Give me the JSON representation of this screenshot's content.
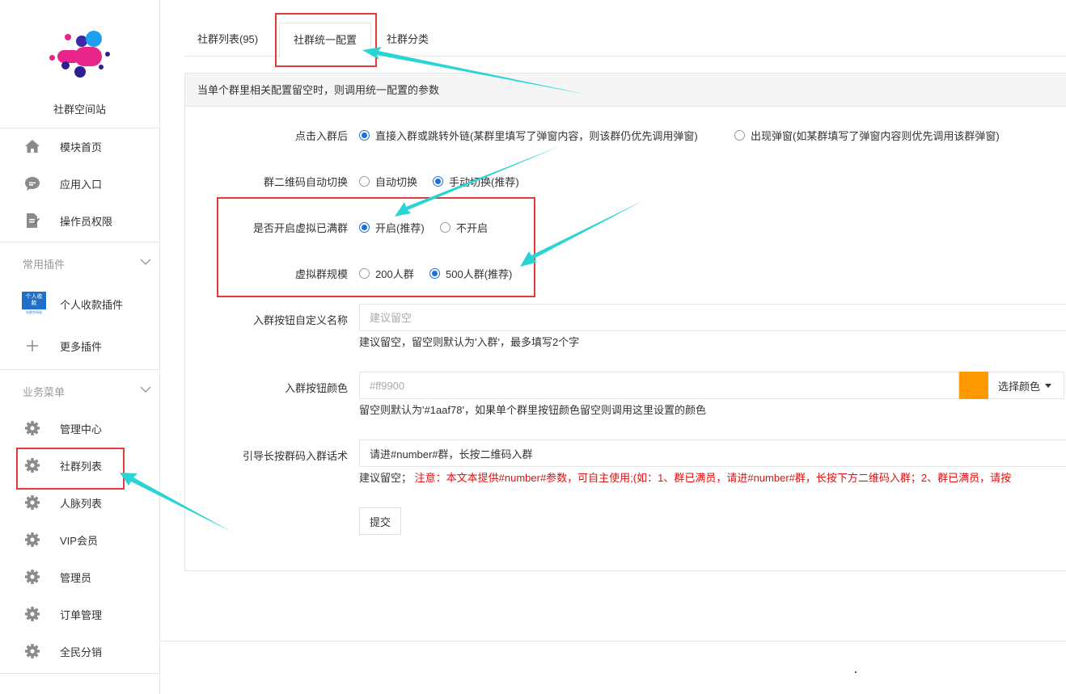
{
  "sidebar": {
    "site_name": "社群空间站",
    "top_items": [
      {
        "label": "模块首页",
        "icon": "home-icon"
      },
      {
        "label": "应用入口",
        "icon": "chat-bubble-icon"
      },
      {
        "label": "操作员权限",
        "icon": "document-edit-icon"
      }
    ],
    "plugins": {
      "title": "常用插件",
      "items": [
        {
          "label": "个人收款插件",
          "icon_text": "个人收款",
          "icon_sub": "社群空间站"
        },
        {
          "label": "更多插件",
          "icon": "plus-icon"
        }
      ]
    },
    "business": {
      "title": "业务菜单",
      "items": [
        {
          "label": "管理中心",
          "icon": "gear-icon"
        },
        {
          "label": "社群列表",
          "icon": "gear-icon"
        },
        {
          "label": "人脉列表",
          "icon": "gear-icon"
        },
        {
          "label": "VIP会员",
          "icon": "gear-icon"
        },
        {
          "label": "管理员",
          "icon": "gear-icon"
        },
        {
          "label": "订单管理",
          "icon": "gear-icon"
        },
        {
          "label": "全民分销",
          "icon": "gear-icon"
        }
      ]
    }
  },
  "tabs": [
    {
      "label": "社群列表(95)",
      "active": false
    },
    {
      "label": "社群统一配置",
      "active": true
    },
    {
      "label": "社群分类",
      "active": false
    }
  ],
  "panel": {
    "heading": "当单个群里相关配置留空时，则调用统一配置的参数",
    "join_action": {
      "label": "点击入群后",
      "options": [
        "直接入群或跳转外链(某群里填写了弹窗内容，则该群仍优先调用弹窗)",
        "出现弹窗(如某群填写了弹窗内容则优先调用该群弹窗)"
      ],
      "selected": 0
    },
    "qr_switch": {
      "label": "群二维码自动切换",
      "options": [
        "自动切换",
        "手动切换(推荐)"
      ],
      "selected": 1
    },
    "virtual_full": {
      "label": "是否开启虚拟已满群",
      "options": [
        "开启(推荐)",
        "不开启"
      ],
      "selected": 0
    },
    "virtual_size": {
      "label": "虚拟群规模",
      "options": [
        "200人群",
        "500人群(推荐)"
      ],
      "selected": 1
    },
    "button_name": {
      "label": "入群按钮自定义名称",
      "placeholder": "建议留空",
      "help": "建议留空，留空则默认为'入群'，最多填写2个字"
    },
    "button_color": {
      "label": "入群按钮颜色",
      "placeholder": "#ff9900",
      "swatch": "#ff9900",
      "picker_label": "选择颜色",
      "help": "留空则默认为'#1aaf78'，如果单个群里按钮颜色留空则调用这里设置的颜色"
    },
    "guide_text": {
      "label": "引导长按群码入群话术",
      "value": "请进#number#群，长按二维码入群",
      "help_prefix": "建议留空；",
      "help_note": "注意：本文本提供#number#参数，可自主使用;(如：1、群已满员，请进#number#群，长按下方二维码入群；2、群已满员，请按"
    },
    "submit_label": "提交"
  },
  "colors": {
    "accent": "#1e6fd9",
    "annotation_box": "#e03c3c",
    "annotation_arrow": "#2ad4d4"
  }
}
